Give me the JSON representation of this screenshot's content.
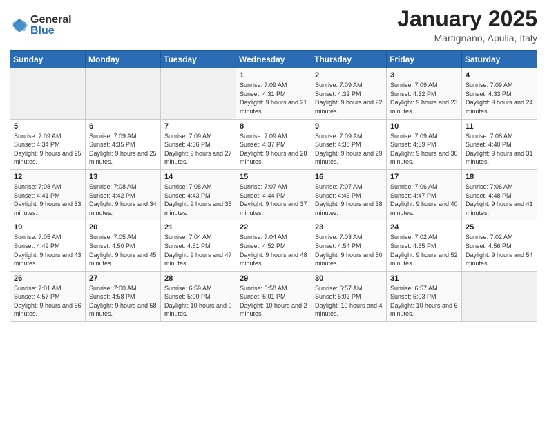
{
  "header": {
    "logo_general": "General",
    "logo_blue": "Blue",
    "month_title": "January 2025",
    "location": "Martignano, Apulia, Italy"
  },
  "days_of_week": [
    "Sunday",
    "Monday",
    "Tuesday",
    "Wednesday",
    "Thursday",
    "Friday",
    "Saturday"
  ],
  "weeks": [
    [
      {
        "day": "",
        "info": ""
      },
      {
        "day": "",
        "info": ""
      },
      {
        "day": "",
        "info": ""
      },
      {
        "day": "1",
        "info": "Sunrise: 7:09 AM\nSunset: 4:31 PM\nDaylight: 9 hours and 21 minutes."
      },
      {
        "day": "2",
        "info": "Sunrise: 7:09 AM\nSunset: 4:32 PM\nDaylight: 9 hours and 22 minutes."
      },
      {
        "day": "3",
        "info": "Sunrise: 7:09 AM\nSunset: 4:32 PM\nDaylight: 9 hours and 23 minutes."
      },
      {
        "day": "4",
        "info": "Sunrise: 7:09 AM\nSunset: 4:33 PM\nDaylight: 9 hours and 24 minutes."
      }
    ],
    [
      {
        "day": "5",
        "info": "Sunrise: 7:09 AM\nSunset: 4:34 PM\nDaylight: 9 hours and 25 minutes."
      },
      {
        "day": "6",
        "info": "Sunrise: 7:09 AM\nSunset: 4:35 PM\nDaylight: 9 hours and 25 minutes."
      },
      {
        "day": "7",
        "info": "Sunrise: 7:09 AM\nSunset: 4:36 PM\nDaylight: 9 hours and 27 minutes."
      },
      {
        "day": "8",
        "info": "Sunrise: 7:09 AM\nSunset: 4:37 PM\nDaylight: 9 hours and 28 minutes."
      },
      {
        "day": "9",
        "info": "Sunrise: 7:09 AM\nSunset: 4:38 PM\nDaylight: 9 hours and 29 minutes."
      },
      {
        "day": "10",
        "info": "Sunrise: 7:09 AM\nSunset: 4:39 PM\nDaylight: 9 hours and 30 minutes."
      },
      {
        "day": "11",
        "info": "Sunrise: 7:08 AM\nSunset: 4:40 PM\nDaylight: 9 hours and 31 minutes."
      }
    ],
    [
      {
        "day": "12",
        "info": "Sunrise: 7:08 AM\nSunset: 4:41 PM\nDaylight: 9 hours and 33 minutes."
      },
      {
        "day": "13",
        "info": "Sunrise: 7:08 AM\nSunset: 4:42 PM\nDaylight: 9 hours and 34 minutes."
      },
      {
        "day": "14",
        "info": "Sunrise: 7:08 AM\nSunset: 4:43 PM\nDaylight: 9 hours and 35 minutes."
      },
      {
        "day": "15",
        "info": "Sunrise: 7:07 AM\nSunset: 4:44 PM\nDaylight: 9 hours and 37 minutes."
      },
      {
        "day": "16",
        "info": "Sunrise: 7:07 AM\nSunset: 4:46 PM\nDaylight: 9 hours and 38 minutes."
      },
      {
        "day": "17",
        "info": "Sunrise: 7:06 AM\nSunset: 4:47 PM\nDaylight: 9 hours and 40 minutes."
      },
      {
        "day": "18",
        "info": "Sunrise: 7:06 AM\nSunset: 4:48 PM\nDaylight: 9 hours and 41 minutes."
      }
    ],
    [
      {
        "day": "19",
        "info": "Sunrise: 7:05 AM\nSunset: 4:49 PM\nDaylight: 9 hours and 43 minutes."
      },
      {
        "day": "20",
        "info": "Sunrise: 7:05 AM\nSunset: 4:50 PM\nDaylight: 9 hours and 45 minutes."
      },
      {
        "day": "21",
        "info": "Sunrise: 7:04 AM\nSunset: 4:51 PM\nDaylight: 9 hours and 47 minutes."
      },
      {
        "day": "22",
        "info": "Sunrise: 7:04 AM\nSunset: 4:52 PM\nDaylight: 9 hours and 48 minutes."
      },
      {
        "day": "23",
        "info": "Sunrise: 7:03 AM\nSunset: 4:54 PM\nDaylight: 9 hours and 50 minutes."
      },
      {
        "day": "24",
        "info": "Sunrise: 7:02 AM\nSunset: 4:55 PM\nDaylight: 9 hours and 52 minutes."
      },
      {
        "day": "25",
        "info": "Sunrise: 7:02 AM\nSunset: 4:56 PM\nDaylight: 9 hours and 54 minutes."
      }
    ],
    [
      {
        "day": "26",
        "info": "Sunrise: 7:01 AM\nSunset: 4:57 PM\nDaylight: 9 hours and 56 minutes."
      },
      {
        "day": "27",
        "info": "Sunrise: 7:00 AM\nSunset: 4:58 PM\nDaylight: 9 hours and 58 minutes."
      },
      {
        "day": "28",
        "info": "Sunrise: 6:59 AM\nSunset: 5:00 PM\nDaylight: 10 hours and 0 minutes."
      },
      {
        "day": "29",
        "info": "Sunrise: 6:58 AM\nSunset: 5:01 PM\nDaylight: 10 hours and 2 minutes."
      },
      {
        "day": "30",
        "info": "Sunrise: 6:57 AM\nSunset: 5:02 PM\nDaylight: 10 hours and 4 minutes."
      },
      {
        "day": "31",
        "info": "Sunrise: 6:57 AM\nSunset: 5:03 PM\nDaylight: 10 hours and 6 minutes."
      },
      {
        "day": "",
        "info": ""
      }
    ]
  ]
}
